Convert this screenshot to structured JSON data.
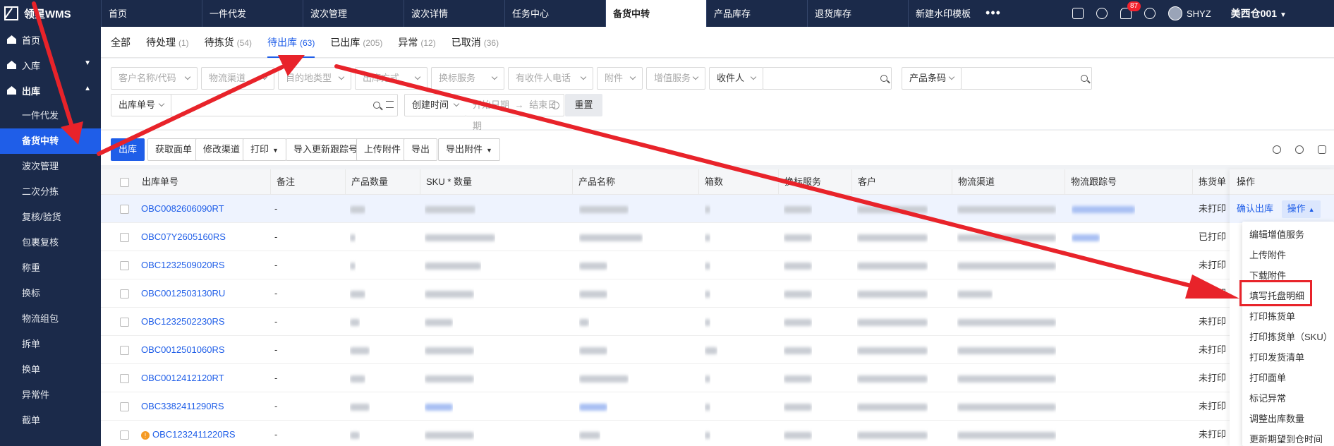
{
  "app": {
    "logo": "领星WMS"
  },
  "nav_tabs": [
    "首页",
    "一件代发",
    "波次管理",
    "波次详情",
    "任务中心",
    "备货中转",
    "产品库存",
    "退货库存",
    "新建水印模板"
  ],
  "nav_more": "•••",
  "header": {
    "notif_count": "87",
    "user": "SHYZ",
    "warehouse": "美西仓001"
  },
  "sidebar": {
    "home": "首页",
    "inbound": "入库",
    "outbound": "出库",
    "items": [
      "一件代发",
      "备货中转",
      "波次管理",
      "二次分拣",
      "复核/验货",
      "包裹复核",
      "称重",
      "换标",
      "物流组包",
      "拆单",
      "换单",
      "异常件",
      "截单"
    ]
  },
  "status_tabs": [
    {
      "label": "全部",
      "count": ""
    },
    {
      "label": "待处理",
      "count": "(1)"
    },
    {
      "label": "待拣货",
      "count": "(54)"
    },
    {
      "label": "待出库",
      "count": "(63)"
    },
    {
      "label": "已出库",
      "count": "(205)"
    },
    {
      "label": "异常",
      "count": "(12)"
    },
    {
      "label": "已取消",
      "count": "(36)"
    }
  ],
  "filters": {
    "customer": "客户名称/代码",
    "channel": "物流渠道",
    "dest": "目的地类型",
    "method": "出库方式",
    "relabel": "换标服务",
    "phone": "有收件人电话",
    "attach": "附件",
    "vas": "增值服务",
    "recipient": "收件人",
    "barcode": "产品条码",
    "order_no": "出库单号",
    "created": "创建时间",
    "start": "开始日期",
    "to": "→",
    "end": "结束日期",
    "reset": "重置"
  },
  "toolbar": {
    "outbound": "出库",
    "get_label": "获取面单",
    "change_channel": "修改渠道",
    "print": "打印",
    "import_tracking": "导入更新跟踪号",
    "upload_attach": "上传附件",
    "export": "导出",
    "export_attach": "导出附件"
  },
  "columns": [
    "出库单号",
    "备注",
    "产品数量",
    "SKU * 数量",
    "产品名称",
    "箱数",
    "换标服务",
    "客户",
    "物流渠道",
    "物流跟踪号",
    "拣货单",
    "操作"
  ],
  "rows": [
    {
      "order": "OBC0082606090RT",
      "remark": "-",
      "pick": "未打印",
      "warn": false
    },
    {
      "order": "OBC07Y2605160RS",
      "remark": "-",
      "pick": "已打印",
      "warn": false
    },
    {
      "order": "OBC1232509020RS",
      "remark": "-",
      "pick": "未打印",
      "warn": false
    },
    {
      "order": "OBC0012503130RU",
      "remark": "-",
      "pick": "未打印",
      "warn": false
    },
    {
      "order": "OBC1232502230RS",
      "remark": "-",
      "pick": "未打印",
      "warn": false
    },
    {
      "order": "OBC0012501060RS",
      "remark": "-",
      "pick": "未打印",
      "warn": false
    },
    {
      "order": "OBC0012412120RT",
      "remark": "-",
      "pick": "未打印",
      "warn": false
    },
    {
      "order": "OBC3382411290RS",
      "remark": "-",
      "pick": "未打印",
      "warn": false
    },
    {
      "order": "OBC1232411220RS",
      "remark": "-",
      "pick": "未打印",
      "warn": true
    }
  ],
  "row_actions": {
    "confirm": "确认出库",
    "ops": "操作"
  },
  "op_menu": [
    "编辑增值服务",
    "上传附件",
    "下载附件",
    "填写托盘明细",
    "打印拣货单",
    "打印拣货单（SKU）",
    "打印发货清单",
    "打印面单",
    "标记异常",
    "调整出库数量",
    "更新期望到仓时间"
  ],
  "accent": "#1f5ee8",
  "annotation_color": "#e8232a"
}
